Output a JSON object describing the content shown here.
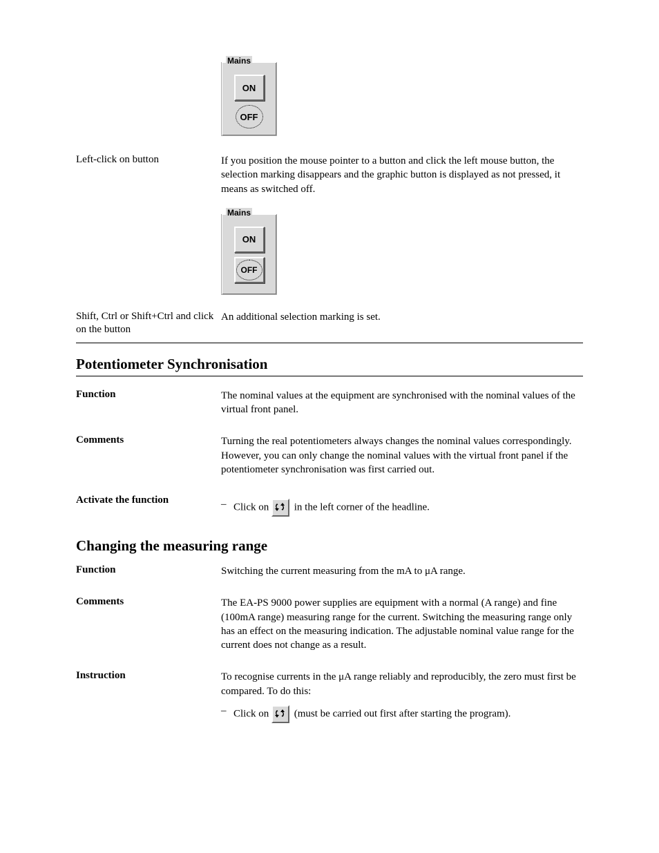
{
  "mains_group_label": "Mains",
  "btn_on": "ON",
  "btn_off": "OFF",
  "r1_label": "Left-click on button",
  "r1_text": "If you position the mouse pointer to a button and click the left mouse button, the selection marking disappears and the graphic button is displayed as not pressed, it means as switched off.",
  "r2_label": "Shift, Ctrl or Shift+Ctrl and click on the button",
  "r2_text": "An additional selection marking is set.",
  "h_poti": "Potentiometer Synchronisation",
  "r3_label": "Function",
  "r3_text": "The nominal values at the equipment are synchronised with the nominal values of the virtual front panel.",
  "r4_label": "Comments",
  "r4_text": "Turning the real potentiometers always changes the nominal values correspondingly. However, you can only change the nominal values with the virtual front panel if the potentiometer synchronisation was first carried out.",
  "r5_label": "Activate the function",
  "r5_bullet": "–",
  "r5_text1": "Click on ",
  "r5_text2": " in the left corner of the headline.",
  "h_mes": "Changing the measuring range",
  "r6_label": "Function",
  "r6_text": "Switching the current measuring from the mA to μA range.",
  "r7_label": "Comments",
  "r7_text": "The EA-PS 9000 power supplies are equipment with a normal (A range) and fine (100mA range) measuring range for the current. Switching the measuring range only has an effect on the measuring indication. The adjustable nominal value range for the current does not change as a result.",
  "r8_label": "Instruction",
  "r8_text": "To recognise currents in the μA range reliably and reproducibly, the zero must first be compared. To do this:",
  "r9_bullet": "–",
  "r9_text1": "Click on ",
  "r9_text2": " (must be carried out first after starting the program)."
}
